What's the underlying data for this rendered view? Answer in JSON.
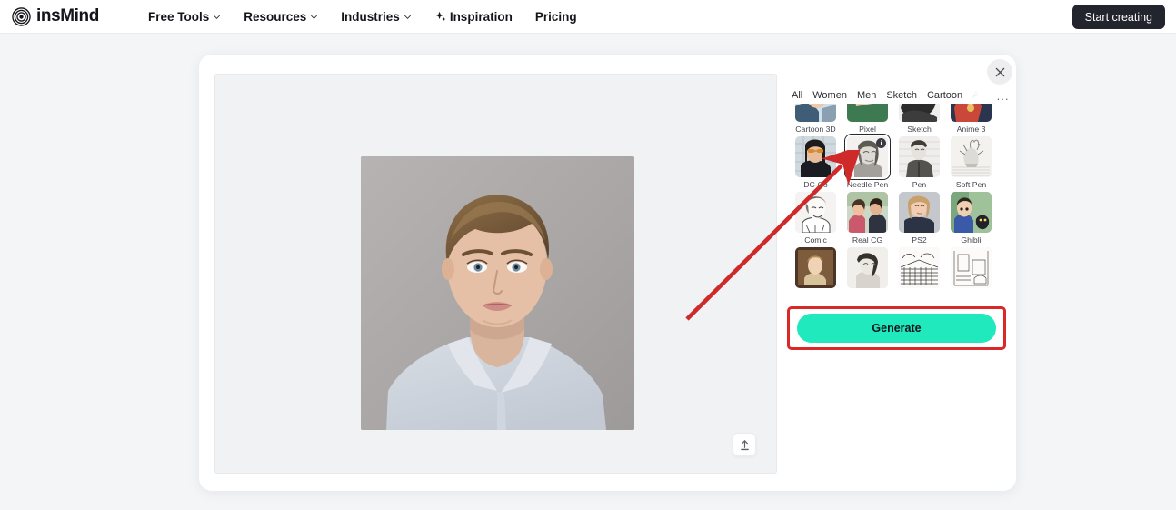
{
  "nav": {
    "brand": "insMind",
    "brand_icon": "spiral-logo-icon",
    "items": [
      {
        "label": "Free Tools",
        "has_chevron": true,
        "icon": null
      },
      {
        "label": "Resources",
        "has_chevron": true,
        "icon": null
      },
      {
        "label": "Industries",
        "has_chevron": true,
        "icon": null
      },
      {
        "label": "Inspiration",
        "has_chevron": false,
        "icon": "sparkle-icon"
      },
      {
        "label": "Pricing",
        "has_chevron": false,
        "icon": null
      }
    ],
    "cta_label": "Start creating"
  },
  "dialog": {
    "close_icon": "close-icon",
    "upload_icon": "upload-icon"
  },
  "panel": {
    "tabs": [
      {
        "label": "All",
        "state": "active"
      },
      {
        "label": "Women",
        "state": "normal"
      },
      {
        "label": "Men",
        "state": "normal"
      },
      {
        "label": "Sketch",
        "state": "normal"
      },
      {
        "label": "Cartoon",
        "state": "normal"
      },
      {
        "label": "An",
        "state": "faded"
      }
    ],
    "overflow_label": "...",
    "styles": [
      {
        "label": "Cartoon 3D",
        "selected": false,
        "badge": null
      },
      {
        "label": "Pixel",
        "selected": false,
        "badge": null
      },
      {
        "label": "Sketch",
        "selected": false,
        "badge": null
      },
      {
        "label": "Anime 3",
        "selected": false,
        "badge": null
      },
      {
        "label": "DC-Co",
        "selected": false,
        "badge": null
      },
      {
        "label": "Needle Pen",
        "selected": true,
        "badge": "i"
      },
      {
        "label": "Pen",
        "selected": false,
        "badge": null
      },
      {
        "label": "Soft Pen",
        "selected": false,
        "badge": null
      },
      {
        "label": "Comic",
        "selected": false,
        "badge": null
      },
      {
        "label": "Real CG",
        "selected": false,
        "badge": null
      },
      {
        "label": "PS2",
        "selected": false,
        "badge": null
      },
      {
        "label": "Ghibli",
        "selected": false,
        "badge": null
      },
      {
        "label": "",
        "selected": false,
        "badge": null
      },
      {
        "label": "",
        "selected": false,
        "badge": null
      },
      {
        "label": "",
        "selected": false,
        "badge": null
      },
      {
        "label": "",
        "selected": false,
        "badge": null
      }
    ]
  },
  "action": {
    "generate_label": "Generate"
  },
  "annotation": {
    "arrow": "red-arrow-pointing-to-needle-pen",
    "highlight": "red-rectangle-around-generate"
  },
  "colors": {
    "accent_teal": "#1fe9bd",
    "annotation_red": "#d82828",
    "cta_dark": "#23252e",
    "page_bg": "#f4f5f7"
  }
}
